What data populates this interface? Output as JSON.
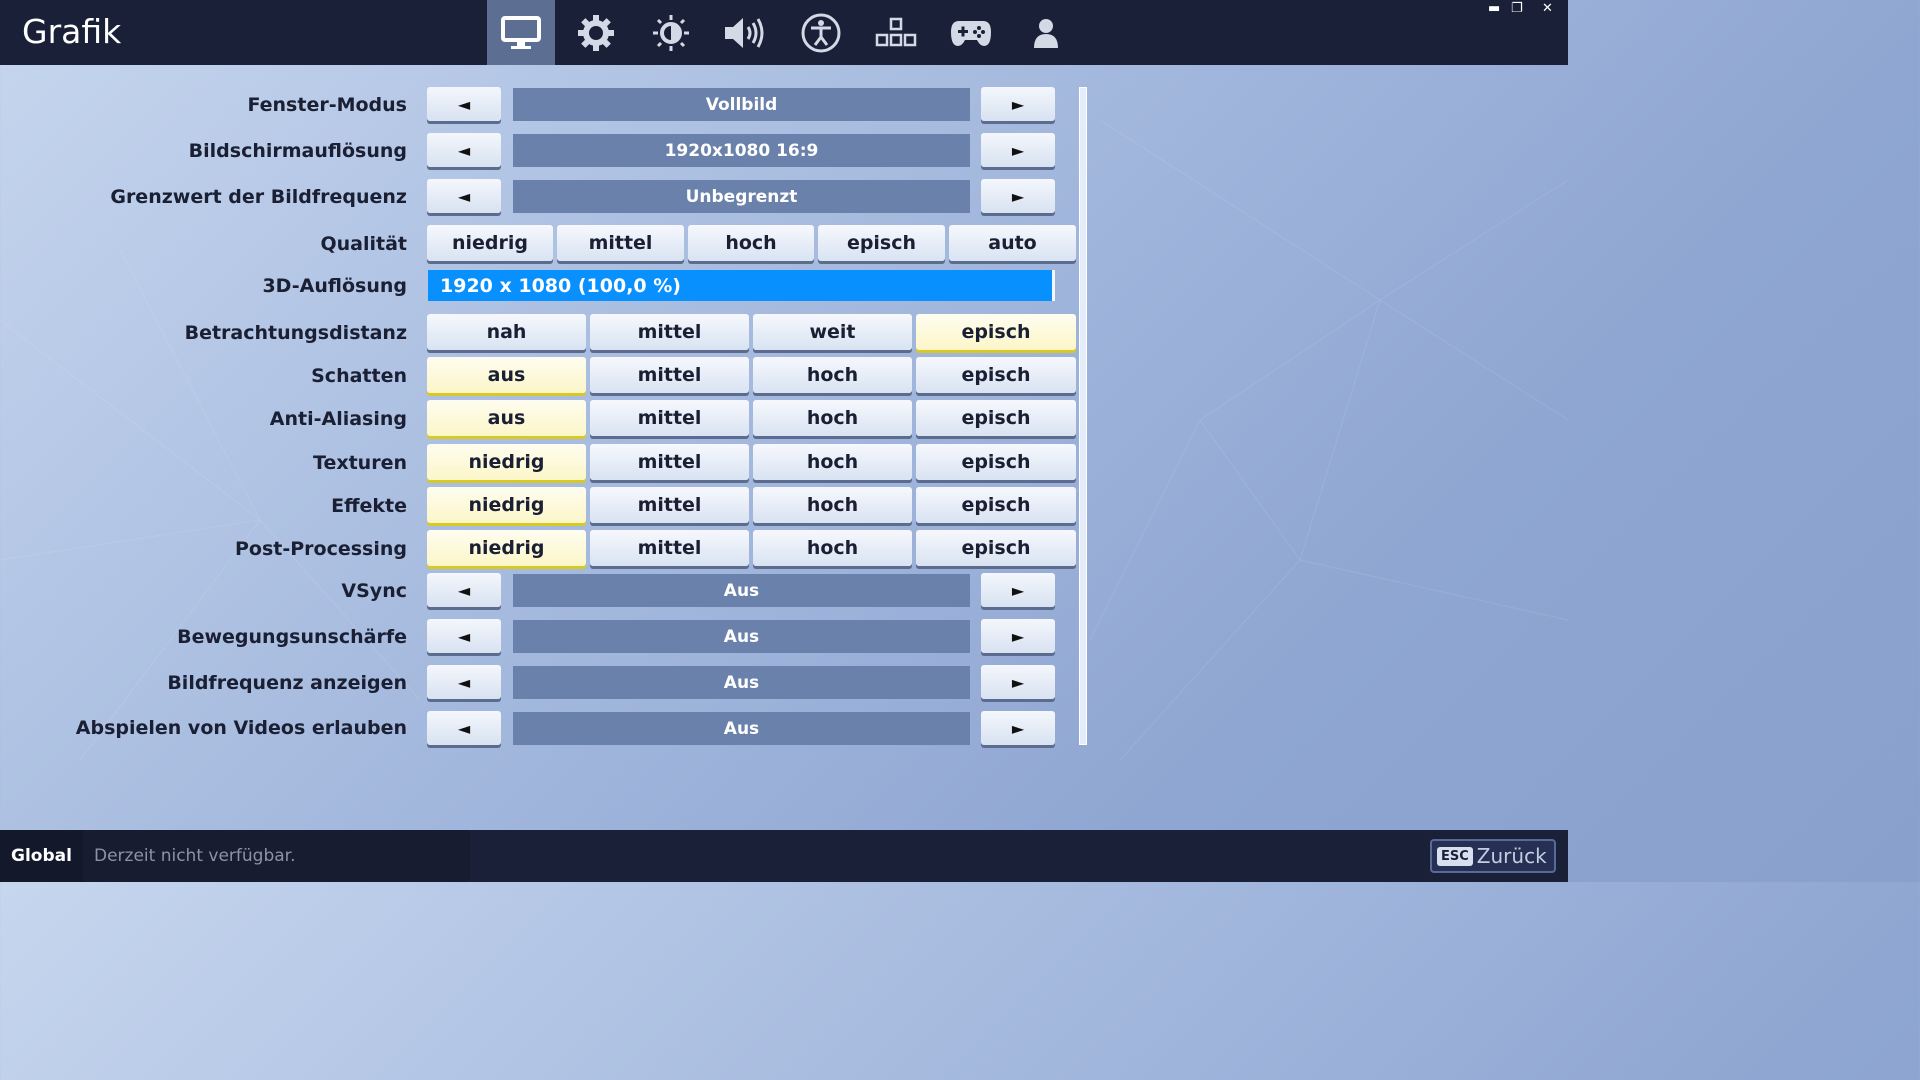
{
  "header": {
    "title": "Grafik",
    "tabs": [
      {
        "icon": "monitor-icon",
        "active": true
      },
      {
        "icon": "gear-icon",
        "active": false
      },
      {
        "icon": "brightness-icon",
        "active": false
      },
      {
        "icon": "speaker-icon",
        "active": false
      },
      {
        "icon": "accessibility-icon",
        "active": false
      },
      {
        "icon": "input-keys-icon",
        "active": false
      },
      {
        "icon": "gamepad-icon",
        "active": false
      },
      {
        "icon": "account-icon",
        "active": false
      }
    ],
    "window_controls": {
      "minimize": "▬",
      "restore": "❐",
      "close": "✕"
    }
  },
  "settings": {
    "window_mode": {
      "label": "Fenster-Modus",
      "value": "Vollbild"
    },
    "resolution": {
      "label": "Bildschirmauflösung",
      "value": "1920x1080 16:9"
    },
    "frame_rate_limit": {
      "label": "Grenzwert der Bildfrequenz",
      "value": "Unbegrenzt"
    },
    "quality": {
      "label": "Qualität",
      "options": [
        "niedrig",
        "mittel",
        "hoch",
        "episch",
        "auto"
      ]
    },
    "resolution_3d": {
      "label": "3D-Auflösung",
      "value": "1920 x 1080 (100,0 %)",
      "fill": 1.0
    },
    "view_distance": {
      "label": "Betrachtungsdistanz",
      "options": [
        "nah",
        "mittel",
        "weit",
        "episch"
      ],
      "selected": 3
    },
    "shadows": {
      "label": "Schatten",
      "options": [
        "aus",
        "mittel",
        "hoch",
        "episch"
      ],
      "selected": 0
    },
    "anti_aliasing": {
      "label": "Anti-Aliasing",
      "options": [
        "aus",
        "mittel",
        "hoch",
        "episch"
      ],
      "selected": 0
    },
    "textures": {
      "label": "Texturen",
      "options": [
        "niedrig",
        "mittel",
        "hoch",
        "episch"
      ],
      "selected": 0
    },
    "effects": {
      "label": "Effekte",
      "options": [
        "niedrig",
        "mittel",
        "hoch",
        "episch"
      ],
      "selected": 0
    },
    "post_processing": {
      "label": "Post-Processing",
      "options": [
        "niedrig",
        "mittel",
        "hoch",
        "episch"
      ],
      "selected": 0
    },
    "vsync": {
      "label": "VSync",
      "value": "Aus"
    },
    "motion_blur": {
      "label": "Bewegungsunschärfe",
      "value": "Aus"
    },
    "show_fps": {
      "label": "Bildfrequenz anzeigen",
      "value": "Aus"
    },
    "allow_videos": {
      "label": "Abspielen von Videos erlauben",
      "value": "Aus"
    }
  },
  "arrows": {
    "left": "◄",
    "right": "►"
  },
  "footer": {
    "global_label": "Global",
    "status": "Derzeit nicht verfügbar.",
    "esc_key": "ESC",
    "back_label": "Zurück"
  },
  "colors": {
    "header_bg": "#1a2038",
    "active_tab": "#5d6e93",
    "value_box": "#6a82ab",
    "slider_fill": "#0990ff",
    "selected_option": "#fbf6c8"
  }
}
